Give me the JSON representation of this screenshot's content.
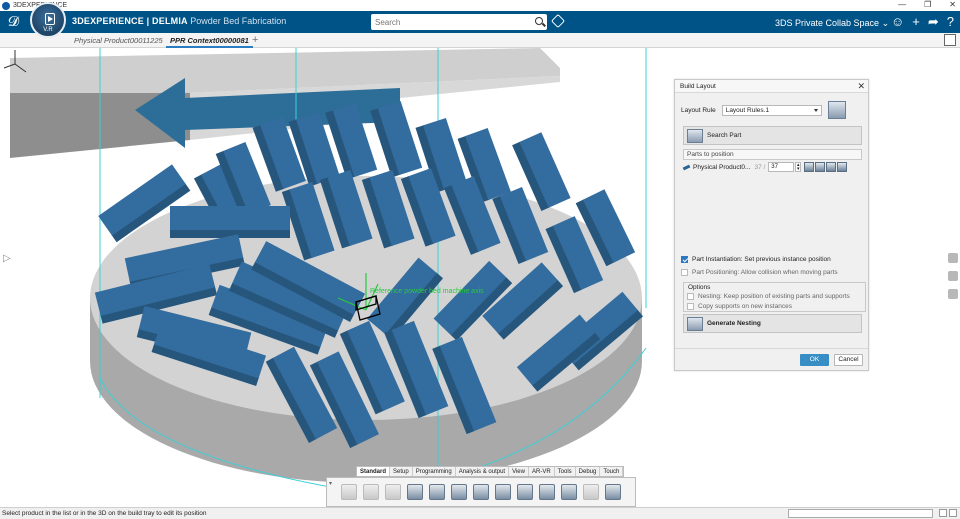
{
  "window": {
    "title": "3DEXPERIENCE",
    "controls": [
      "—",
      "❐",
      "✕"
    ]
  },
  "header": {
    "compass_version": "V.R",
    "brand_bold": "3DEXPERIENCE | DELMIA",
    "brand_light": "Powder Bed Fabrication",
    "search_placeholder": "Search",
    "space_label": "3DS Private Collab Space",
    "icons": [
      "user-icon",
      "add-icon",
      "share-icon",
      "help-icon"
    ],
    "icon_glyphs": [
      "☺",
      "+",
      "➦",
      "?"
    ]
  },
  "tabs": [
    {
      "label": "Physical Product00011225",
      "active": false
    },
    {
      "label": "PPR Context00000081",
      "active": true
    }
  ],
  "viewport": {
    "axis_label": "Reference powder bed machine axis",
    "accent_color": "#336C9E",
    "plate_color": "#D3D3D3",
    "guide_color": "#3BD0D6"
  },
  "build_layout": {
    "title": "Build Layout",
    "layout_rule_label": "Layout Rule",
    "layout_rule_value": "Layout Rules.1",
    "search_part_label": "Search Part",
    "parts_to_position_label": "Parts to position",
    "part": {
      "name": "Physical Product0...",
      "count": "37 /",
      "quantity": "37"
    },
    "part_instantiation": {
      "label": "Part Instantiation: Set previous instance position",
      "checked": true
    },
    "part_positioning": {
      "label": "Part Positioning: Allow collision when moving parts",
      "checked": false
    },
    "options_label": "Options",
    "nesting_keep": {
      "label": "Nesting: Keep position of existing parts and supports",
      "checked": false
    },
    "copy_supports": {
      "label": "Copy supports on new instances",
      "checked": false
    },
    "generate_nesting_label": "Generate Nesting",
    "ok_label": "OK",
    "cancel_label": "Cancel"
  },
  "action_bar": {
    "tabs": [
      "Standard",
      "Setup",
      "Programming",
      "Analysis & output",
      "View",
      "AR-VR",
      "Tools",
      "Debug",
      "Touch"
    ],
    "active_tab": "Standard"
  },
  "status_bar": {
    "message": "Select product in the list or in the 3D on the build tray to edit its position"
  }
}
